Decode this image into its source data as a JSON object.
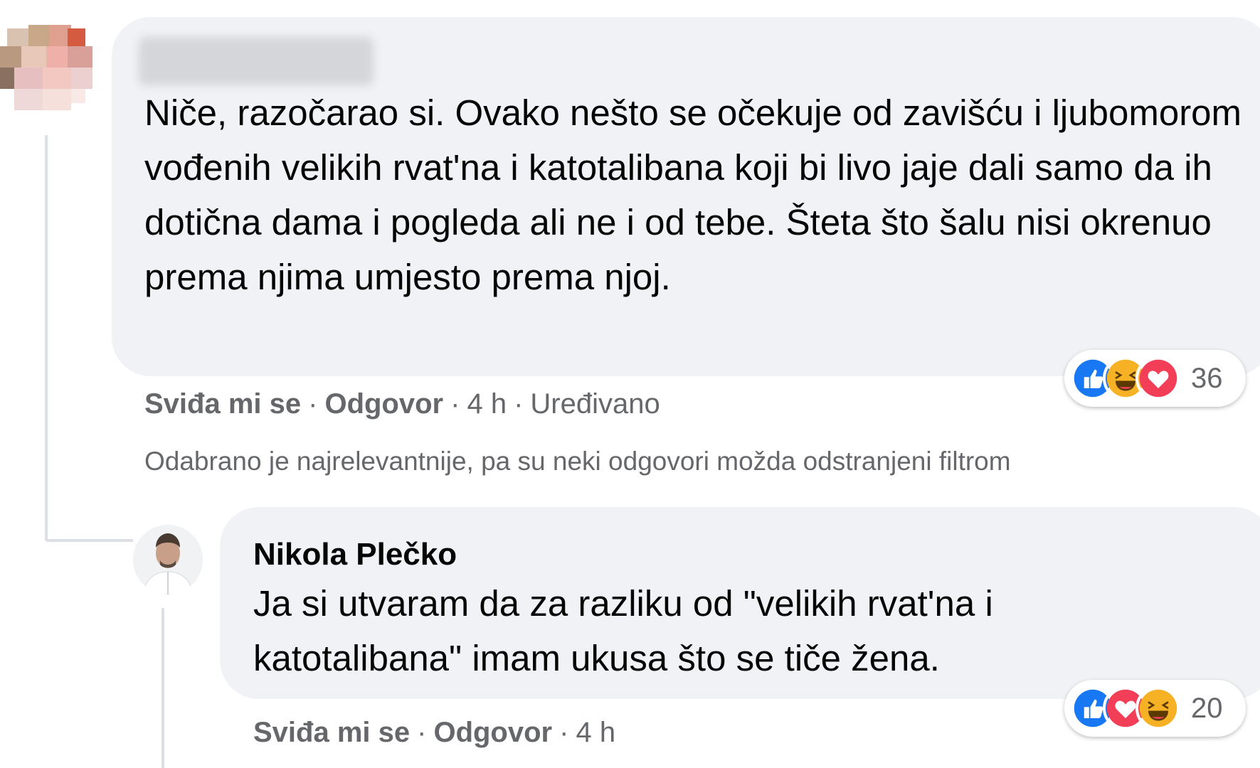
{
  "comment": {
    "author_blurred": "",
    "text": "Niče, razočarao si. Ovako nešto se očekuje od zavišću i ljubomorom vođenih velikih rvat'na i katotalibana koji bi livo jaje dali samo da ih dotična dama i pogleda ali ne i od tebe. Šteta što šalu nisi okrenuo prema njima umjesto prema njoj.",
    "reactions": {
      "icons": [
        "like-icon",
        "haha-icon",
        "love-icon"
      ],
      "count": "36"
    },
    "actions": {
      "like": "Sviđa mi se",
      "reply": "Odgovor",
      "time": "4 h",
      "edited": "Uređivano",
      "dot": "·"
    }
  },
  "filter_note": "Odabrano je najrelevantnije, pa su neki odgovori možda odstranjeni filtrom",
  "reply": {
    "author": "Nikola Plečko",
    "text": "Ja si utvaram da za razliku od \"velikih rvat'na i katotalibana\" imam ukusa što se tiče žena.",
    "reactions": {
      "icons": [
        "like-icon",
        "love-icon",
        "haha-icon"
      ],
      "count": "20"
    },
    "actions": {
      "like": "Sviđa mi se",
      "reply": "Odgovor",
      "time": "4 h",
      "dot": "·"
    }
  },
  "colors": {
    "bubble": "#f0f2f5",
    "like": "#1877f2",
    "love": "#f33e58",
    "haha": "#f7b125",
    "muted": "#65676b"
  }
}
